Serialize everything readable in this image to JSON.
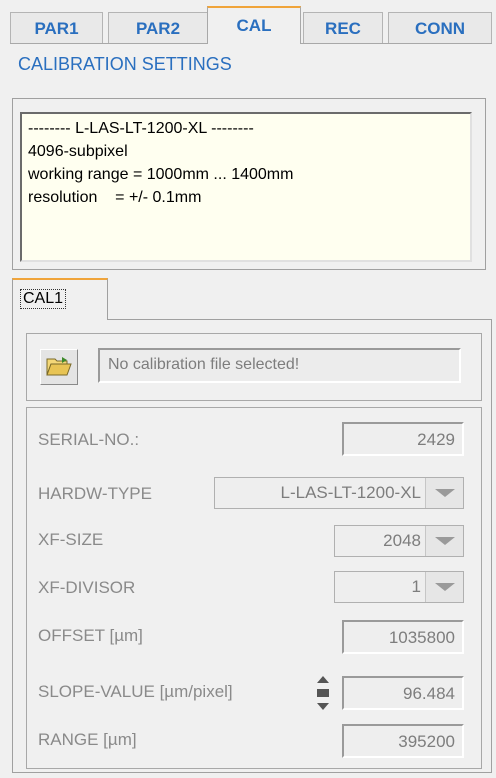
{
  "tabs": [
    "PAR1",
    "PAR2",
    "CAL",
    "REC",
    "CONN"
  ],
  "active_tab": "CAL",
  "section_title": "CALIBRATION SETTINGS",
  "info": {
    "line1": "-------- L-LAS-LT-1200-XL --------",
    "line2": "4096-subpixel",
    "line3": "working range = 1000mm ... 1400mm",
    "line4": "resolution    = +/- 0.1mm"
  },
  "subtab_label": "CAL1",
  "file": {
    "icon": "folder-open-icon",
    "text": "No calibration file selected!"
  },
  "params": {
    "serial": {
      "label": "SERIAL-NO.:",
      "value": "2429"
    },
    "hardw": {
      "label": "HARDW-TYPE",
      "value": "L-LAS-LT-1200-XL"
    },
    "xfsize": {
      "label": "XF-SIZE",
      "value": "2048"
    },
    "xfdiv": {
      "label": "XF-DIVISOR",
      "value": "1"
    },
    "offset": {
      "label": "OFFSET  [µm]",
      "value": "1035800"
    },
    "slope": {
      "label": "SLOPE-VALUE [µm/pixel]",
      "value": "96.484"
    },
    "range": {
      "label": "RANGE  [µm]",
      "value": "395200"
    }
  },
  "colors": {
    "tab_text": "#2a6fbf",
    "active_accent": "#f0a43a",
    "disabled_text": "#8a8a8a"
  }
}
